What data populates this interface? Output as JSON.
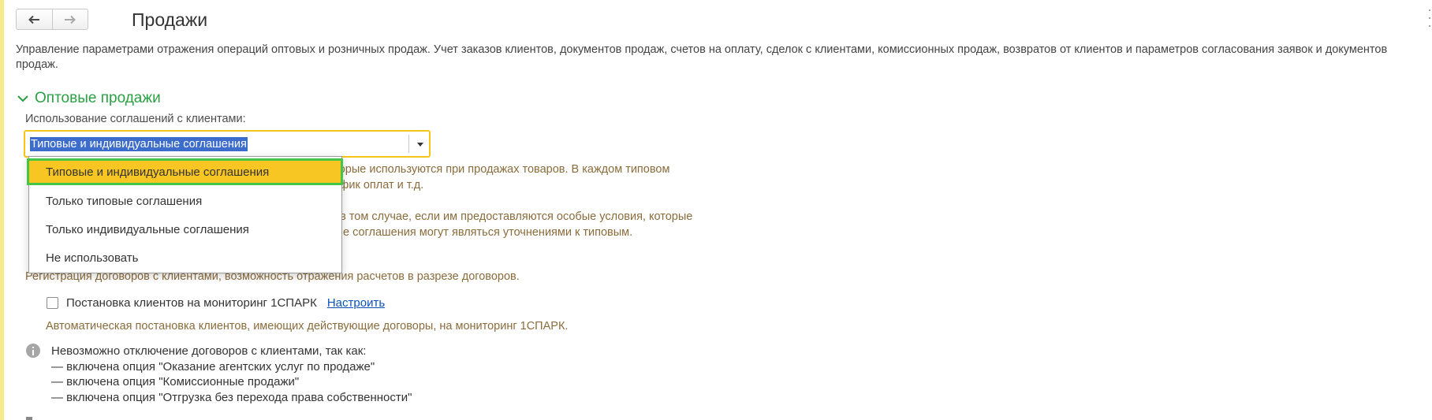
{
  "header": {
    "title": "Продажи",
    "back_icon": "arrow-left-icon",
    "forward_icon": "arrow-right-icon"
  },
  "description": "Управление параметрами отражения операций оптовых и розничных продаж. Учет заказов клиентов, документов продаж, счетов на оплату, сделок с клиентами, комиссионных продаж, возвратов от клиентов и параметров согласования заявок и документов продаж.",
  "section": {
    "title": "Оптовые продажи",
    "agreements": {
      "label": "Использование соглашений с клиентами:",
      "value": "Типовые и индивидуальные соглашения",
      "options": [
        "Типовые и индивидуальные соглашения",
        "Только типовые соглашения",
        "Только индивидуальные соглашения",
        "Не использовать"
      ],
      "note1_line1": "которые используются при продажах товаров. В каждом типовом",
      "note1_line2": "график оплат и т.д.",
      "note2_line1": "ми в том случае, если им предоставляются особые условия, которые",
      "note2_line2": "ьные соглашения могут являться уточнениями к типовым."
    },
    "contracts_note": "Регистрация договоров с клиентами, возможность отражения расчетов в разрезе договоров.",
    "monitoring": {
      "label": "Постановка клиентов на мониторинг 1СПАРК",
      "link": "Настроить",
      "hint": "Автоматическая постановка клиентов, имеющих действующие договоры, на мониторинг 1СПАРК."
    },
    "info": {
      "icon": "info-icon",
      "lines": [
        "Невозможно отключение договоров с клиентами, так как:",
        "— включена опция \"Оказание агентских услуг по продаже\"",
        "— включена опция \"Комиссионные продажи\"",
        "— включена опция \"Отгрузка без перехода права собственности\""
      ]
    }
  },
  "colors": {
    "accent_green": "#2aa043",
    "selection_yellow": "#f8c623",
    "focus_border": "#f5c518",
    "link_blue": "#0b52b7",
    "note_brown": "#8a6c3c"
  }
}
